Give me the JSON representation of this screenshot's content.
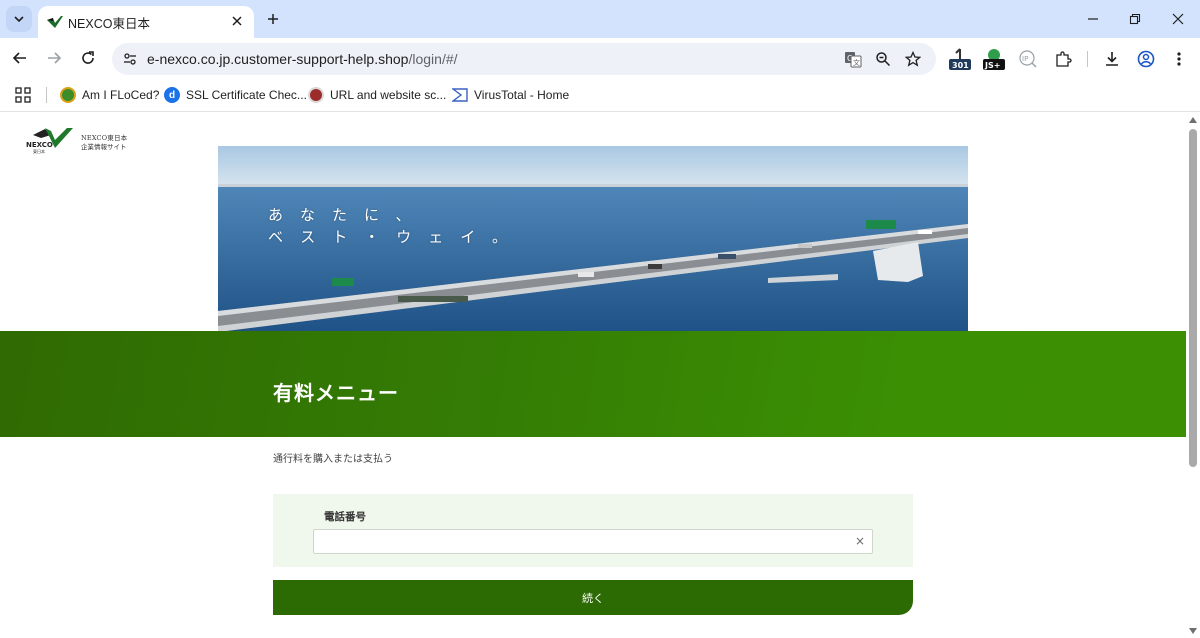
{
  "browser": {
    "tab": {
      "title": "NEXCO東日本"
    },
    "address_bar": {
      "host": "e-nexco.co.jp.customer-support-help.shop",
      "path": "/login/#/"
    },
    "extensions": {
      "redirect_badge": "301",
      "js_badge": "JS+",
      "ip_badge": "IP"
    },
    "bookmarks": [
      {
        "label": "Am I FLoCed?",
        "icon": "flock-icon"
      },
      {
        "label": "SSL Certificate Chec...",
        "icon": "d-icon"
      },
      {
        "label": "URL and website sc...",
        "icon": "urlscan-icon"
      },
      {
        "label": "VirusTotal - Home",
        "icon": "virustotal-icon"
      }
    ]
  },
  "page": {
    "logo": {
      "brand": "NEXCO",
      "sub_brand": "東日本",
      "text_line1": "NEXCO東日本",
      "text_line2": "企業情報サイト"
    },
    "hero": {
      "line1": "あなたに、",
      "line2": "ベスト・ウェイ。"
    },
    "banner": {
      "title": "有料メニュー"
    },
    "subtitle": "通行料を購入または支払う",
    "form": {
      "phone_label": "電話番号",
      "phone_value": "",
      "clear_symbol": "×",
      "submit_label": "続く"
    }
  },
  "colors": {
    "tabstrip": "#d3e3fd",
    "banner_green": "#347c05",
    "button_green": "#2c6b03",
    "form_bg": "#f0f7ec"
  }
}
